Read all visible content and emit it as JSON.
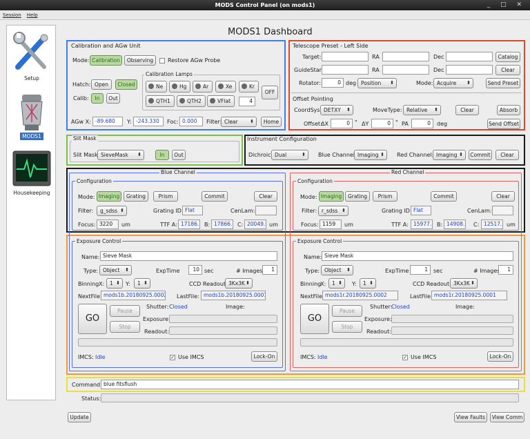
{
  "window": {
    "title": "MODS Control Panel (on mods1)",
    "controls": "_ □ ✕"
  },
  "menu": [
    "Session",
    "Help"
  ],
  "sidebar": [
    {
      "label": "Setup",
      "icon": "tools-icon"
    },
    {
      "label": "MODS1",
      "icon": "instrument-icon"
    },
    {
      "label": "Housekeeping",
      "icon": "monitor-icon"
    }
  ],
  "dashboard_title": "MODS1 Dashboard",
  "cal": {
    "title": "Calibration and AGw Unit",
    "mode_label": "Mode:",
    "mode_cal": "Calibration",
    "mode_obs": "Observing",
    "restore": "Restore AGw Probe",
    "hatch_label": "Hatch:",
    "open": "Open",
    "closed": "Closed",
    "calib_label": "Calib:",
    "in": "In",
    "out": "Out",
    "lamps_title": "Calibration Lamps",
    "lamps": [
      "Ne",
      "Hg",
      "Ar",
      "Xe",
      "Kr",
      "QTH1",
      "QTH2",
      "VFlat"
    ],
    "off": "OFF",
    "vflat_value": "4",
    "agwx_label": "AGw X:",
    "agwx": "-89.680",
    "y_label": "Y:",
    "y": "-243.330",
    "foc_label": "Foc:",
    "foc": "0.000",
    "filter_label": "Filter:",
    "filter": "Clear",
    "home": "Home"
  },
  "tel": {
    "title": "Telescope Preset - Left Side",
    "target": "Target:",
    "ra": "RA",
    "dec": "Dec",
    "catalog": "Catalog",
    "guidestar": "GuideStar:",
    "clear": "Clear",
    "rotator": "Rotator:",
    "rot_value": "0",
    "deg": "deg",
    "rot_mode": "Position",
    "mode_label": "Mode:",
    "mode": "Acquire",
    "send_preset": "Send Preset",
    "offset_title": "Offset Pointing",
    "coordsys_label": "CoordSys:",
    "coordsys": "DETXY",
    "movetype_label": "MoveType:",
    "movetype": "Relative",
    "clear2": "Clear",
    "absorb": "Absorb",
    "offset_label": "Offset:",
    "dx_label": "ΔX",
    "dx": "0",
    "dy_label": "ΔY",
    "dy": "0",
    "unit_sec": "\"",
    "pa_label": "PA",
    "pa": "0",
    "send_offset": "Send Offset"
  },
  "slit": {
    "title": "Slit Mask",
    "label": "Slit Mask:",
    "value": "SieveMask",
    "in": "In",
    "out": "Out"
  },
  "inst": {
    "title": "Instrument Configuration",
    "dichroic_label": "Dichroic:",
    "dichroic": "Dual",
    "blue_label": "Blue Channel:",
    "blue": "Imaging",
    "red_label": "Red Channel:",
    "red": "Imaging",
    "commit": "Commit",
    "clear": "Clear"
  },
  "blue": {
    "title": "Blue Channel",
    "cfg": "Configuration",
    "mode_label": "Mode:",
    "imaging": "Imaging",
    "grating": "Grating",
    "prism": "Prism",
    "commit": "Commit",
    "clear": "Clear",
    "filter_label": "Filter:",
    "filter": "g_sdss",
    "gid_label": "Grating ID:",
    "gid": "Flat",
    "cenlam_label": "CenLam:",
    "focus_label": "Focus:",
    "focus": "3220",
    "um": "um",
    "ttfa_label": "TTF A:",
    "ttfa": "17186.",
    "b_label": "B:",
    "b": "17866.",
    "c_label": "C:",
    "c": "20049.",
    "exp": {
      "title": "Exposure Control",
      "name_label": "Name:",
      "name": "Sieve Mask",
      "type_label": "Type:",
      "type": "Object",
      "exptime_label": "ExpTime",
      "exptime": "10",
      "sec": "sec",
      "nimg_label": "# Images:",
      "nimg": "1",
      "binning_label": "Binning",
      "x_label": "X:",
      "x": "1",
      "y_label": "Y:",
      "y": "1",
      "ccd_label": "CCD Readout:",
      "ccd": "3Kx3K",
      "next_label": "NextFile:",
      "next": "mods1b.20180925.0002",
      "last_label": "LastFile:",
      "last": "mods1b.20180925.0001",
      "go": "GO",
      "pause": "Pause",
      "stop": "Stop",
      "shutter_label": "Shutter:",
      "shutter": "Closed",
      "image_label": "Image:",
      "exposure_label": "Exposure:",
      "readout_label": "Readout:",
      "imcs_label": "IMCS:",
      "imcs": "Idle",
      "use_imcs": "Use IMCS",
      "lockon": "Lock-On"
    }
  },
  "red": {
    "title": "Red Channel",
    "cfg": "Configuration",
    "mode_label": "Mode:",
    "imaging": "Imaging",
    "grating": "Grating",
    "prism": "Prism",
    "commit": "Commit",
    "clear": "Clear",
    "filter_label": "Filter:",
    "filter": "r_sdss",
    "gid_label": "Grating ID:",
    "gid": "Flat",
    "cenlam_label": "CenLam:",
    "focus_label": "Focus:",
    "focus": "1159",
    "um": "um",
    "ttfa_label": "TTF A:",
    "ttfa": "15977.",
    "b_label": "B:",
    "b": "14908.",
    "c_label": "C:",
    "c": "12517.",
    "exp": {
      "title": "Exposure Control",
      "name_label": "Name:",
      "name": "Sieve Mask",
      "type_label": "Type:",
      "type": "Object",
      "exptime_label": "ExpTime",
      "exptime": "1",
      "sec": "sec",
      "nimg_label": "# Images:",
      "nimg": "1",
      "binning_label": "Binning",
      "x_label": "X:",
      "x": "1",
      "y_label": "Y:",
      "y": "1",
      "ccd_label": "CCD Readout:",
      "ccd": "3Kx3K",
      "next_label": "NextFile:",
      "next": "mods1r.20180925.0002",
      "last_label": "LastFile:",
      "last": "mods1r.20180925.0001",
      "go": "GO",
      "pause": "Pause",
      "stop": "Stop",
      "shutter_label": "Shutter:",
      "shutter": "Closed",
      "image_label": "Image:",
      "exposure_label": "Exposure:",
      "readout_label": "Readout:",
      "imcs_label": "IMCS:",
      "imcs": "Idle",
      "use_imcs": "Use IMCS",
      "lockon": "Lock-On"
    }
  },
  "command": {
    "label": "Command:",
    "value": "blue fitsflush",
    "status_label": "Status:"
  },
  "footer": {
    "update": "Update",
    "view_faults": "View Faults",
    "view_comm": "View Comm"
  },
  "colors": {
    "blue_frame": "#3d7fe6",
    "red_frame": "#d9482b",
    "green_frame": "#7bc043",
    "black_frame": "#1a1a1a",
    "orange_frame": "#f19a3a",
    "yellow_frame": "#e8e040",
    "blue_group": "#5a6fe0",
    "red_group": "#e06060"
  }
}
